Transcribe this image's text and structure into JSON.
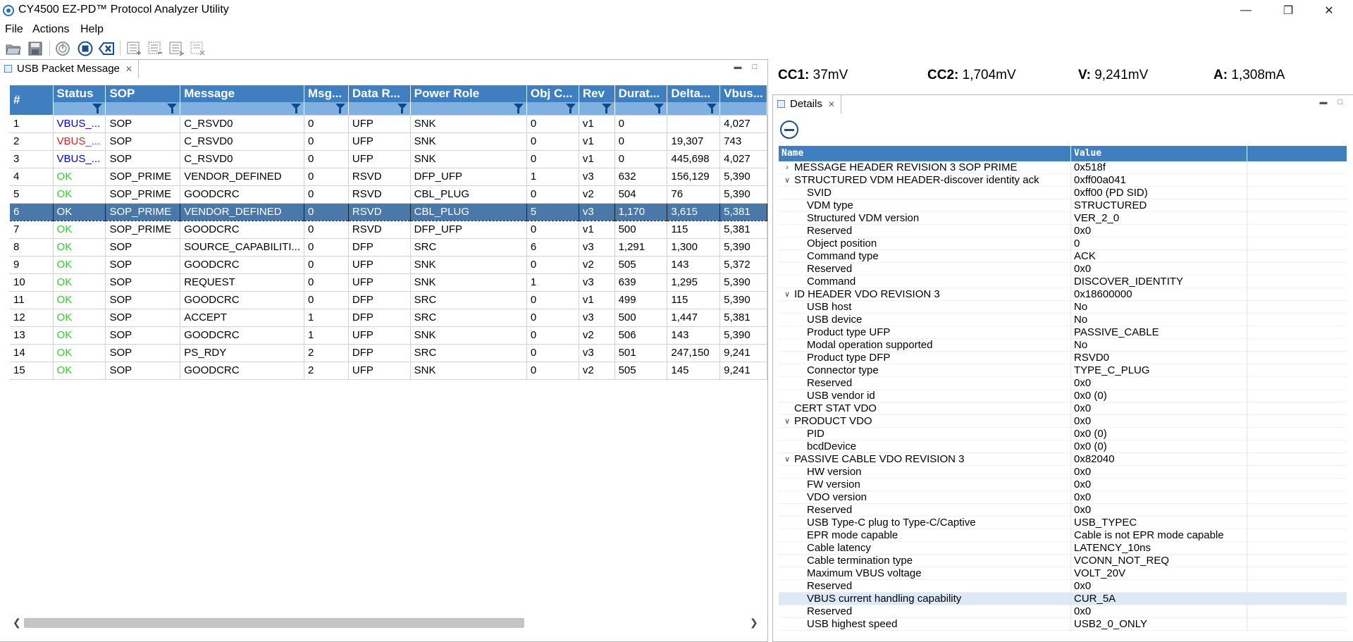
{
  "window": {
    "title": "CY4500 EZ-PD™ Protocol Analyzer Utility"
  },
  "menu": [
    "File",
    "Actions",
    "Help"
  ],
  "left_tab": {
    "label": "USB Packet Message"
  },
  "right_tab": {
    "label": "Details"
  },
  "packets": {
    "columns": [
      "#",
      "Status",
      "SOP",
      "Message",
      "Msg...",
      "Data R...",
      "Power Role",
      "Obj C...",
      "Rev",
      "Durat...",
      "Delta...",
      "Vbus..."
    ],
    "rows": [
      {
        "n": "1",
        "status": "VBUS_...",
        "status_color": "blue",
        "sop": "SOP",
        "msg": "C_RSVD0",
        "msgid": "0",
        "data": "UFP",
        "power": "SNK",
        "obj": "0",
        "rev": "v1",
        "dur": "0",
        "delta": "",
        "vbus": "4,027"
      },
      {
        "n": "2",
        "status": "VBUS_...",
        "status_color": "red",
        "sop": "SOP",
        "msg": "C_RSVD0",
        "msgid": "0",
        "data": "UFP",
        "power": "SNK",
        "obj": "0",
        "rev": "v1",
        "dur": "0",
        "delta": "19,307",
        "vbus": "743"
      },
      {
        "n": "3",
        "status": "VBUS_...",
        "status_color": "blue",
        "sop": "SOP",
        "msg": "C_RSVD0",
        "msgid": "0",
        "data": "UFP",
        "power": "SNK",
        "obj": "0",
        "rev": "v1",
        "dur": "0",
        "delta": "445,698",
        "vbus": "4,027"
      },
      {
        "n": "4",
        "status": "OK",
        "status_color": "ok",
        "sop": "SOP_PRIME",
        "msg": "VENDOR_DEFINED",
        "msgid": "0",
        "data": "RSVD",
        "power": "DFP_UFP",
        "obj": "1",
        "rev": "v3",
        "dur": "632",
        "delta": "156,129",
        "vbus": "5,390"
      },
      {
        "n": "5",
        "status": "OK",
        "status_color": "ok",
        "sop": "SOP_PRIME",
        "msg": "GOODCRC",
        "msgid": "0",
        "data": "RSVD",
        "power": "CBL_PLUG",
        "obj": "0",
        "rev": "v2",
        "dur": "504",
        "delta": "76",
        "vbus": "5,390"
      },
      {
        "n": "6",
        "status": "OK",
        "status_color": "ok",
        "sop": "SOP_PRIME",
        "msg": "VENDOR_DEFINED",
        "msgid": "0",
        "data": "RSVD",
        "power": "CBL_PLUG",
        "obj": "5",
        "rev": "v3",
        "dur": "1,170",
        "delta": "3,615",
        "vbus": "5,381",
        "selected": true
      },
      {
        "n": "7",
        "status": "OK",
        "status_color": "ok",
        "sop": "SOP_PRIME",
        "msg": "GOODCRC",
        "msgid": "0",
        "data": "RSVD",
        "power": "DFP_UFP",
        "obj": "0",
        "rev": "v1",
        "dur": "500",
        "delta": "115",
        "vbus": "5,381"
      },
      {
        "n": "8",
        "status": "OK",
        "status_color": "ok",
        "sop": "SOP",
        "msg": "SOURCE_CAPABILITI...",
        "msgid": "0",
        "data": "DFP",
        "power": "SRC",
        "obj": "6",
        "rev": "v3",
        "dur": "1,291",
        "delta": "1,300",
        "vbus": "5,390"
      },
      {
        "n": "9",
        "status": "OK",
        "status_color": "ok",
        "sop": "SOP",
        "msg": "GOODCRC",
        "msgid": "0",
        "data": "UFP",
        "power": "SNK",
        "obj": "0",
        "rev": "v2",
        "dur": "505",
        "delta": "143",
        "vbus": "5,372"
      },
      {
        "n": "10",
        "status": "OK",
        "status_color": "ok",
        "sop": "SOP",
        "msg": "REQUEST",
        "msgid": "0",
        "data": "UFP",
        "power": "SNK",
        "obj": "1",
        "rev": "v3",
        "dur": "639",
        "delta": "1,295",
        "vbus": "5,390"
      },
      {
        "n": "11",
        "status": "OK",
        "status_color": "ok",
        "sop": "SOP",
        "msg": "GOODCRC",
        "msgid": "0",
        "data": "DFP",
        "power": "SRC",
        "obj": "0",
        "rev": "v1",
        "dur": "499",
        "delta": "115",
        "vbus": "5,390"
      },
      {
        "n": "12",
        "status": "OK",
        "status_color": "ok",
        "sop": "SOP",
        "msg": "ACCEPT",
        "msgid": "1",
        "data": "DFP",
        "power": "SRC",
        "obj": "0",
        "rev": "v3",
        "dur": "500",
        "delta": "1,447",
        "vbus": "5,381"
      },
      {
        "n": "13",
        "status": "OK",
        "status_color": "ok",
        "sop": "SOP",
        "msg": "GOODCRC",
        "msgid": "1",
        "data": "UFP",
        "power": "SNK",
        "obj": "0",
        "rev": "v2",
        "dur": "506",
        "delta": "143",
        "vbus": "5,390"
      },
      {
        "n": "14",
        "status": "OK",
        "status_color": "ok",
        "sop": "SOP",
        "msg": "PS_RDY",
        "msgid": "2",
        "data": "DFP",
        "power": "SRC",
        "obj": "0",
        "rev": "v3",
        "dur": "501",
        "delta": "247,150",
        "vbus": "9,241"
      },
      {
        "n": "15",
        "status": "OK",
        "status_color": "ok",
        "sop": "SOP",
        "msg": "GOODCRC",
        "msgid": "2",
        "data": "UFP",
        "power": "SNK",
        "obj": "0",
        "rev": "v2",
        "dur": "505",
        "delta": "145",
        "vbus": "9,241"
      }
    ]
  },
  "readings": {
    "cc1_label": "CC1:",
    "cc1_value": "37mV",
    "cc2_label": "CC2:",
    "cc2_value": "1,704mV",
    "v_label": "V:",
    "v_value": "9,241mV",
    "a_label": "A:",
    "a_value": "1,308mA"
  },
  "details": {
    "header_name": "Name",
    "header_value": "Value",
    "rows": [
      {
        "name": "MESSAGE HEADER REVISION 3 SOP PRIME",
        "value": "0x518f",
        "level": 0,
        "twisty": "collapsed"
      },
      {
        "name": "STRUCTURED VDM HEADER-discover identity ack",
        "value": "0xff00a041",
        "level": 0,
        "twisty": "expanded"
      },
      {
        "name": "SVID",
        "value": "0xff00 (PD SID)",
        "level": 1
      },
      {
        "name": "VDM type",
        "value": "STRUCTURED",
        "level": 1
      },
      {
        "name": "Structured VDM version",
        "value": "VER_2_0",
        "level": 1
      },
      {
        "name": "Reserved",
        "value": "0x0",
        "level": 1
      },
      {
        "name": "Object position",
        "value": "0",
        "level": 1
      },
      {
        "name": "Command type",
        "value": "ACK",
        "level": 1
      },
      {
        "name": "Reserved",
        "value": "0x0",
        "level": 1
      },
      {
        "name": "Command",
        "value": "DISCOVER_IDENTITY",
        "level": 1
      },
      {
        "name": "ID HEADER VDO REVISION 3",
        "value": "0x18600000",
        "level": 0,
        "twisty": "expanded"
      },
      {
        "name": "USB host",
        "value": "No",
        "level": 1
      },
      {
        "name": "USB device",
        "value": "No",
        "level": 1
      },
      {
        "name": "Product type UFP",
        "value": "PASSIVE_CABLE",
        "level": 1
      },
      {
        "name": "Modal operation supported",
        "value": "No",
        "level": 1
      },
      {
        "name": "Product type DFP",
        "value": "RSVD0",
        "level": 1
      },
      {
        "name": "Connector type",
        "value": "TYPE_C_PLUG",
        "level": 1
      },
      {
        "name": "Reserved",
        "value": "0x0",
        "level": 1
      },
      {
        "name": "USB vendor id",
        "value": "0x0 (0)",
        "level": 1
      },
      {
        "name": "CERT STAT VDO",
        "value": "0x0",
        "level": 0
      },
      {
        "name": "PRODUCT VDO",
        "value": "0x0",
        "level": 0,
        "twisty": "expanded"
      },
      {
        "name": "PID",
        "value": "0x0 (0)",
        "level": 1
      },
      {
        "name": "bcdDevice",
        "value": "0x0 (0)",
        "level": 1
      },
      {
        "name": "PASSIVE CABLE VDO REVISION 3",
        "value": "0x82040",
        "level": 0,
        "twisty": "expanded"
      },
      {
        "name": "HW version",
        "value": "0x0",
        "level": 1
      },
      {
        "name": "FW version",
        "value": "0x0",
        "level": 1
      },
      {
        "name": "VDO version",
        "value": "0x0",
        "level": 1
      },
      {
        "name": "Reserved",
        "value": "0x0",
        "level": 1
      },
      {
        "name": "USB Type-C plug to Type-C/Captive",
        "value": "USB_TYPEC",
        "level": 1
      },
      {
        "name": "EPR mode capable",
        "value": "Cable is not EPR mode capable",
        "level": 1
      },
      {
        "name": "Cable latency",
        "value": "LATENCY_10ns",
        "level": 1
      },
      {
        "name": "Cable termination type",
        "value": "VCONN_NOT_REQ",
        "level": 1
      },
      {
        "name": "Maximum VBUS voltage",
        "value": "VOLT_20V",
        "level": 1
      },
      {
        "name": "Reserved",
        "value": "0x0",
        "level": 1
      },
      {
        "name": "VBUS current handling capability",
        "value": "CUR_5A",
        "level": 1,
        "highlighted": true
      },
      {
        "name": "Reserved",
        "value": "0x0",
        "level": 1
      },
      {
        "name": "USB highest speed",
        "value": "USB2_0_ONLY",
        "level": 1
      }
    ]
  },
  "colors": {
    "header": "#3f7fbf",
    "filter_row": "#7fb0e0",
    "selected_row": "#4a78a8",
    "ok": "#33cc33",
    "blue": "#0000e0",
    "red": "#e02020"
  }
}
